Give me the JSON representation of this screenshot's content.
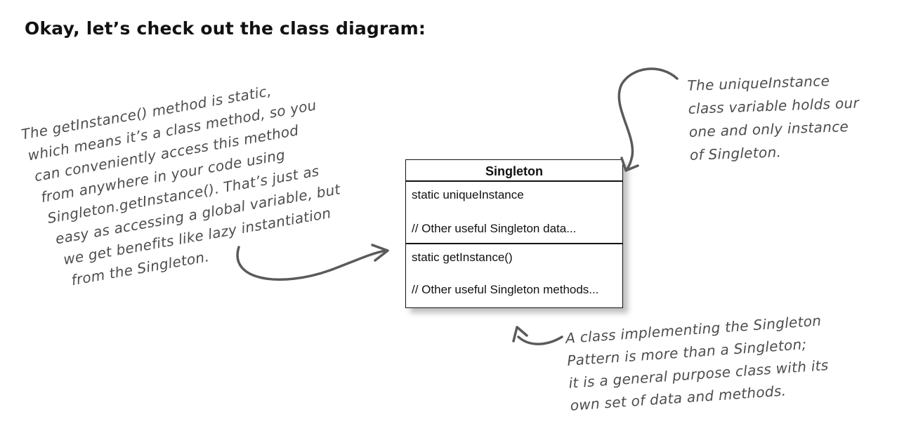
{
  "heading": "Okay, let’s check out the class diagram:",
  "uml_class": {
    "name": "Singleton",
    "attributes": [
      "static uniqueInstance",
      "// Other useful Singleton data..."
    ],
    "methods": [
      "static getInstance()",
      "// Other useful Singleton methods..."
    ]
  },
  "annotations": {
    "get_instance_note": [
      "The getInstance() method is static,",
      "which means it’s a class method, so you",
      "can conveniently access this method",
      "from anywhere in your code using",
      "Singleton.getInstance(). That’s just as",
      "easy as accessing a global variable, but",
      "we get benefits like lazy instantiation",
      "from the Singleton."
    ],
    "unique_instance_note": [
      "The uniqueInstance",
      "class variable holds our",
      "one and only instance",
      "of Singleton."
    ],
    "general_purpose_note": [
      "A class implementing the Singleton",
      "Pattern is more than a Singleton;",
      "it is a general purpose class with its",
      "own set of data and methods."
    ]
  },
  "colors": {
    "annotation_ink": "#4d4d4d",
    "diagram_ink": "#111111",
    "background": "#ffffff"
  }
}
